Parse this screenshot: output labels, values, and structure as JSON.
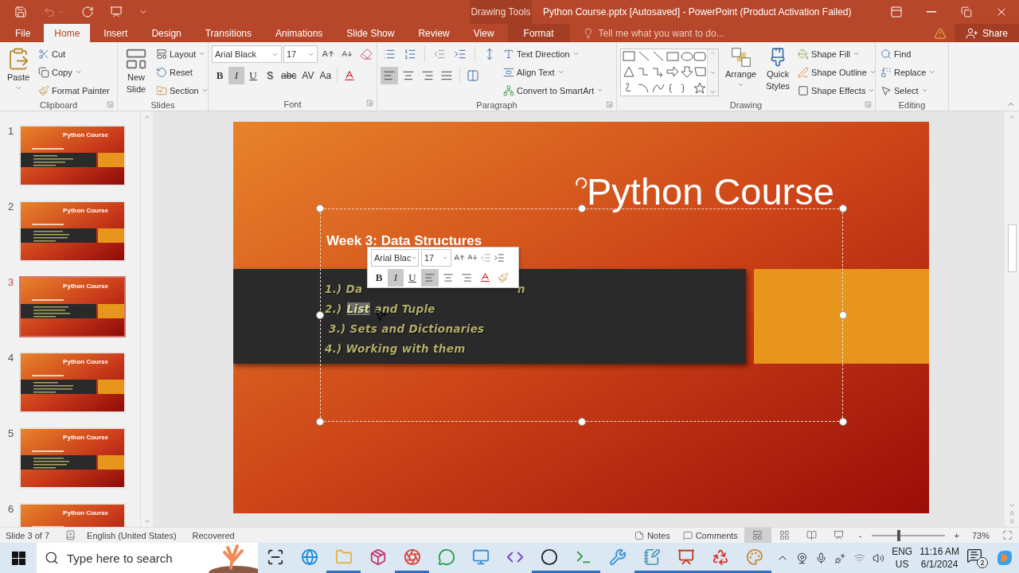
{
  "window": {
    "context_label": "Drawing Tools",
    "title": "Python Course.pptx [Autosaved] - PowerPoint (Product Activation Failed)"
  },
  "tabs": [
    {
      "label": "File",
      "selected": false,
      "kind": "main"
    },
    {
      "label": "Home",
      "selected": true,
      "kind": "main"
    },
    {
      "label": "Insert",
      "selected": false,
      "kind": "main"
    },
    {
      "label": "Design",
      "selected": false,
      "kind": "main"
    },
    {
      "label": "Transitions",
      "selected": false,
      "kind": "main"
    },
    {
      "label": "Animations",
      "selected": false,
      "kind": "main"
    },
    {
      "label": "Slide Show",
      "selected": false,
      "kind": "main"
    },
    {
      "label": "Review",
      "selected": false,
      "kind": "main"
    },
    {
      "label": "View",
      "selected": false,
      "kind": "main"
    },
    {
      "label": "Format",
      "selected": false,
      "kind": "context"
    }
  ],
  "tell_me": {
    "placeholder": "Tell me what you want to do..."
  },
  "share": "Share",
  "clipboard": {
    "label": "Clipboard",
    "paste": "Paste",
    "cut": "Cut",
    "copy": "Copy",
    "format_painter": "Format Painter"
  },
  "slides_group": {
    "label": "Slides",
    "new_slide": "New",
    "new_slide_2": "Slide",
    "layout": "Layout",
    "reset": "Reset",
    "section": "Section"
  },
  "font": {
    "label": "Font",
    "name": "Arial Black",
    "size": "17",
    "buttons": [
      {
        "label": "B",
        "kind": "bold",
        "selected": false
      },
      {
        "label": "I",
        "kind": "italic",
        "selected": true
      },
      {
        "label": "U",
        "kind": "underline",
        "selected": false
      },
      {
        "label": "S",
        "kind": "shadow",
        "selected": false
      },
      {
        "label": "abc",
        "kind": "strike",
        "selected": false
      },
      {
        "label": "AV",
        "kind": "spacing",
        "selected": false
      },
      {
        "label": "Aa",
        "kind": "case",
        "selected": false
      }
    ]
  },
  "paragraph": {
    "label": "Paragraph",
    "text_direction": "Text Direction",
    "align_text": "Align Text",
    "smartart": "Convert to SmartArt",
    "alignments": [
      {
        "kind": "left",
        "selected": true
      },
      {
        "kind": "center",
        "selected": false
      },
      {
        "kind": "right",
        "selected": false
      },
      {
        "kind": "justify",
        "selected": false
      }
    ]
  },
  "drawing": {
    "label": "Drawing",
    "arrange": "Arrange",
    "quick_styles": "Quick",
    "quick_styles_2": "Styles",
    "shape_fill": "Shape Fill",
    "shape_outline": "Shape Outline",
    "shape_effects": "Shape Effects"
  },
  "editing": {
    "label": "Editing",
    "find": "Find",
    "replace": "Replace",
    "select": "Select"
  },
  "thumbnails": [
    {
      "number": "1",
      "title": "Python Course",
      "selected": false
    },
    {
      "number": "2",
      "title": "Python Course",
      "selected": false
    },
    {
      "number": "3",
      "title": "Python Course",
      "selected": true
    },
    {
      "number": "4",
      "title": "Python Course",
      "selected": false
    },
    {
      "number": "5",
      "title": "Python Course",
      "selected": false
    },
    {
      "number": "6",
      "title": "Python Course",
      "selected": false
    }
  ],
  "slide": {
    "title": "Python Course",
    "heading": "Week 3: Data Structures",
    "items": [
      {
        "parts": [
          {
            "text": "1.) Da",
            "selected": false,
            "kind": "plain"
          },
          {
            "text": "n",
            "selected": false,
            "kind": "after_gap"
          }
        ]
      },
      {
        "parts": [
          {
            "text": "2.)",
            "selected": false,
            "kind": "plain"
          },
          {
            "text": "List",
            "selected": true,
            "kind": "plain"
          },
          {
            "text": "and Tuple",
            "selected": false,
            "kind": "plain"
          }
        ]
      },
      {
        "parts": [
          {
            "text": "3.) Sets and Dictionaries",
            "selected": false,
            "kind": "indented"
          }
        ]
      },
      {
        "parts": [
          {
            "text": "4.) Working with them",
            "selected": false,
            "kind": "plain"
          }
        ]
      }
    ]
  },
  "mini_toolbar": {
    "font": "Arial Blac",
    "size": "17",
    "buttons": [
      {
        "label": "B",
        "kind": "bold",
        "selected": false
      },
      {
        "label": "I",
        "kind": "italic",
        "selected": true
      },
      {
        "label": "U",
        "kind": "underline",
        "selected": false
      }
    ],
    "alignments": [
      {
        "kind": "left",
        "selected": true
      },
      {
        "kind": "center",
        "selected": false
      },
      {
        "kind": "right",
        "selected": false
      }
    ]
  },
  "status_bar": {
    "slide": "Slide 3 of 7",
    "language": "English (United States)",
    "state": "Recovered",
    "notes": "Notes",
    "comments": "Comments",
    "views": [
      {
        "kind": "normal",
        "selected": true
      },
      {
        "kind": "sorter",
        "selected": false
      },
      {
        "kind": "reading",
        "selected": false
      },
      {
        "kind": "show",
        "selected": false
      }
    ],
    "zoom_out": "-",
    "zoom_in": "+",
    "zoom": {
      "level": 0.38
    },
    "zoom_text": "73%"
  },
  "taskbar": {
    "search": {
      "placeholder": "Type here to search"
    },
    "apps": [
      {
        "kind": "taskview",
        "running": false
      },
      {
        "kind": "edge",
        "running": false
      },
      {
        "kind": "files",
        "running": true
      },
      {
        "kind": "store",
        "running": false
      },
      {
        "kind": "chrome",
        "running": true
      },
      {
        "kind": "whatsapp",
        "running": false
      },
      {
        "kind": "monitor",
        "running": false
      },
      {
        "kind": "vs",
        "running": false
      },
      {
        "kind": "obs",
        "running": true
      },
      {
        "kind": "pycharm",
        "running": true
      },
      {
        "kind": "tools",
        "running": false
      },
      {
        "kind": "notepad",
        "running": true
      },
      {
        "kind": "powerpoint",
        "running": true
      },
      {
        "kind": "cleaner",
        "running": true
      },
      {
        "kind": "paint",
        "running": true
      }
    ],
    "language": "ENG",
    "region": "US",
    "time": "11:16 AM",
    "date": "6/1/2024",
    "notifications": "2"
  }
}
